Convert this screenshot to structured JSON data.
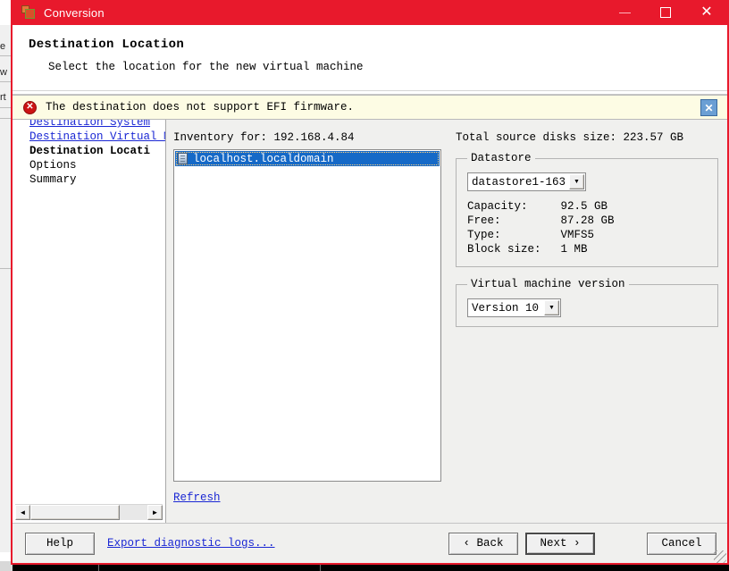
{
  "window": {
    "title": "Conversion",
    "icon": "conversion-app-icon",
    "minimize_label": "—",
    "maximize_label": "☐",
    "close_label": "✕"
  },
  "header": {
    "title": "Destination Location",
    "subtitle": "Select the location for the new virtual machine"
  },
  "banner": {
    "icon": "error-icon",
    "icon_glyph": "✕",
    "message": "The destination does not support EFI firmware.",
    "close_label": "✕"
  },
  "sidebar": {
    "items": [
      {
        "label": "Destination System",
        "state": "link"
      },
      {
        "label": "Destination Virtual M",
        "state": "link"
      },
      {
        "label": "Destination Locati",
        "state": "current"
      },
      {
        "label": "Options",
        "state": "normal"
      },
      {
        "label": "Summary",
        "state": "normal"
      }
    ],
    "scrollbar": {
      "left_arrow": "◄",
      "right_arrow": "►"
    }
  },
  "inventory": {
    "label": "Inventory for: 192.168.4.84",
    "rows": [
      {
        "label": "localhost.localdomain",
        "icon": "server-icon",
        "selected": true
      }
    ],
    "refresh_label": "Refresh"
  },
  "details": {
    "total_source_disks": "Total source disks size: 223.57 GB",
    "datastore": {
      "legend": "Datastore",
      "selected": "datastore1-163",
      "dropdown_arrow": "▼",
      "fields": [
        {
          "key": "Capacity:",
          "value": "92.5 GB"
        },
        {
          "key": "Free:",
          "value": "87.28 GB"
        },
        {
          "key": "Type:",
          "value": "VMFS5"
        },
        {
          "key": "Block size:",
          "value": "1 MB"
        }
      ]
    },
    "vm_version": {
      "legend": "Virtual machine version",
      "selected": "Version 10",
      "dropdown_arrow": "▼"
    }
  },
  "footer": {
    "help_label": "Help",
    "export_logs_label": "Export diagnostic logs...",
    "back_label": "‹ Back",
    "next_label": "Next ›",
    "cancel_label": "Cancel"
  },
  "background": {
    "fragments": [
      "e",
      "w",
      "rt"
    ]
  },
  "colors": {
    "titlebar": "#e8192c",
    "banner_bg": "#fdfce4",
    "link": "#1a27d4",
    "selection": "#1569c7",
    "dialog_bg": "#f0f0ee"
  }
}
